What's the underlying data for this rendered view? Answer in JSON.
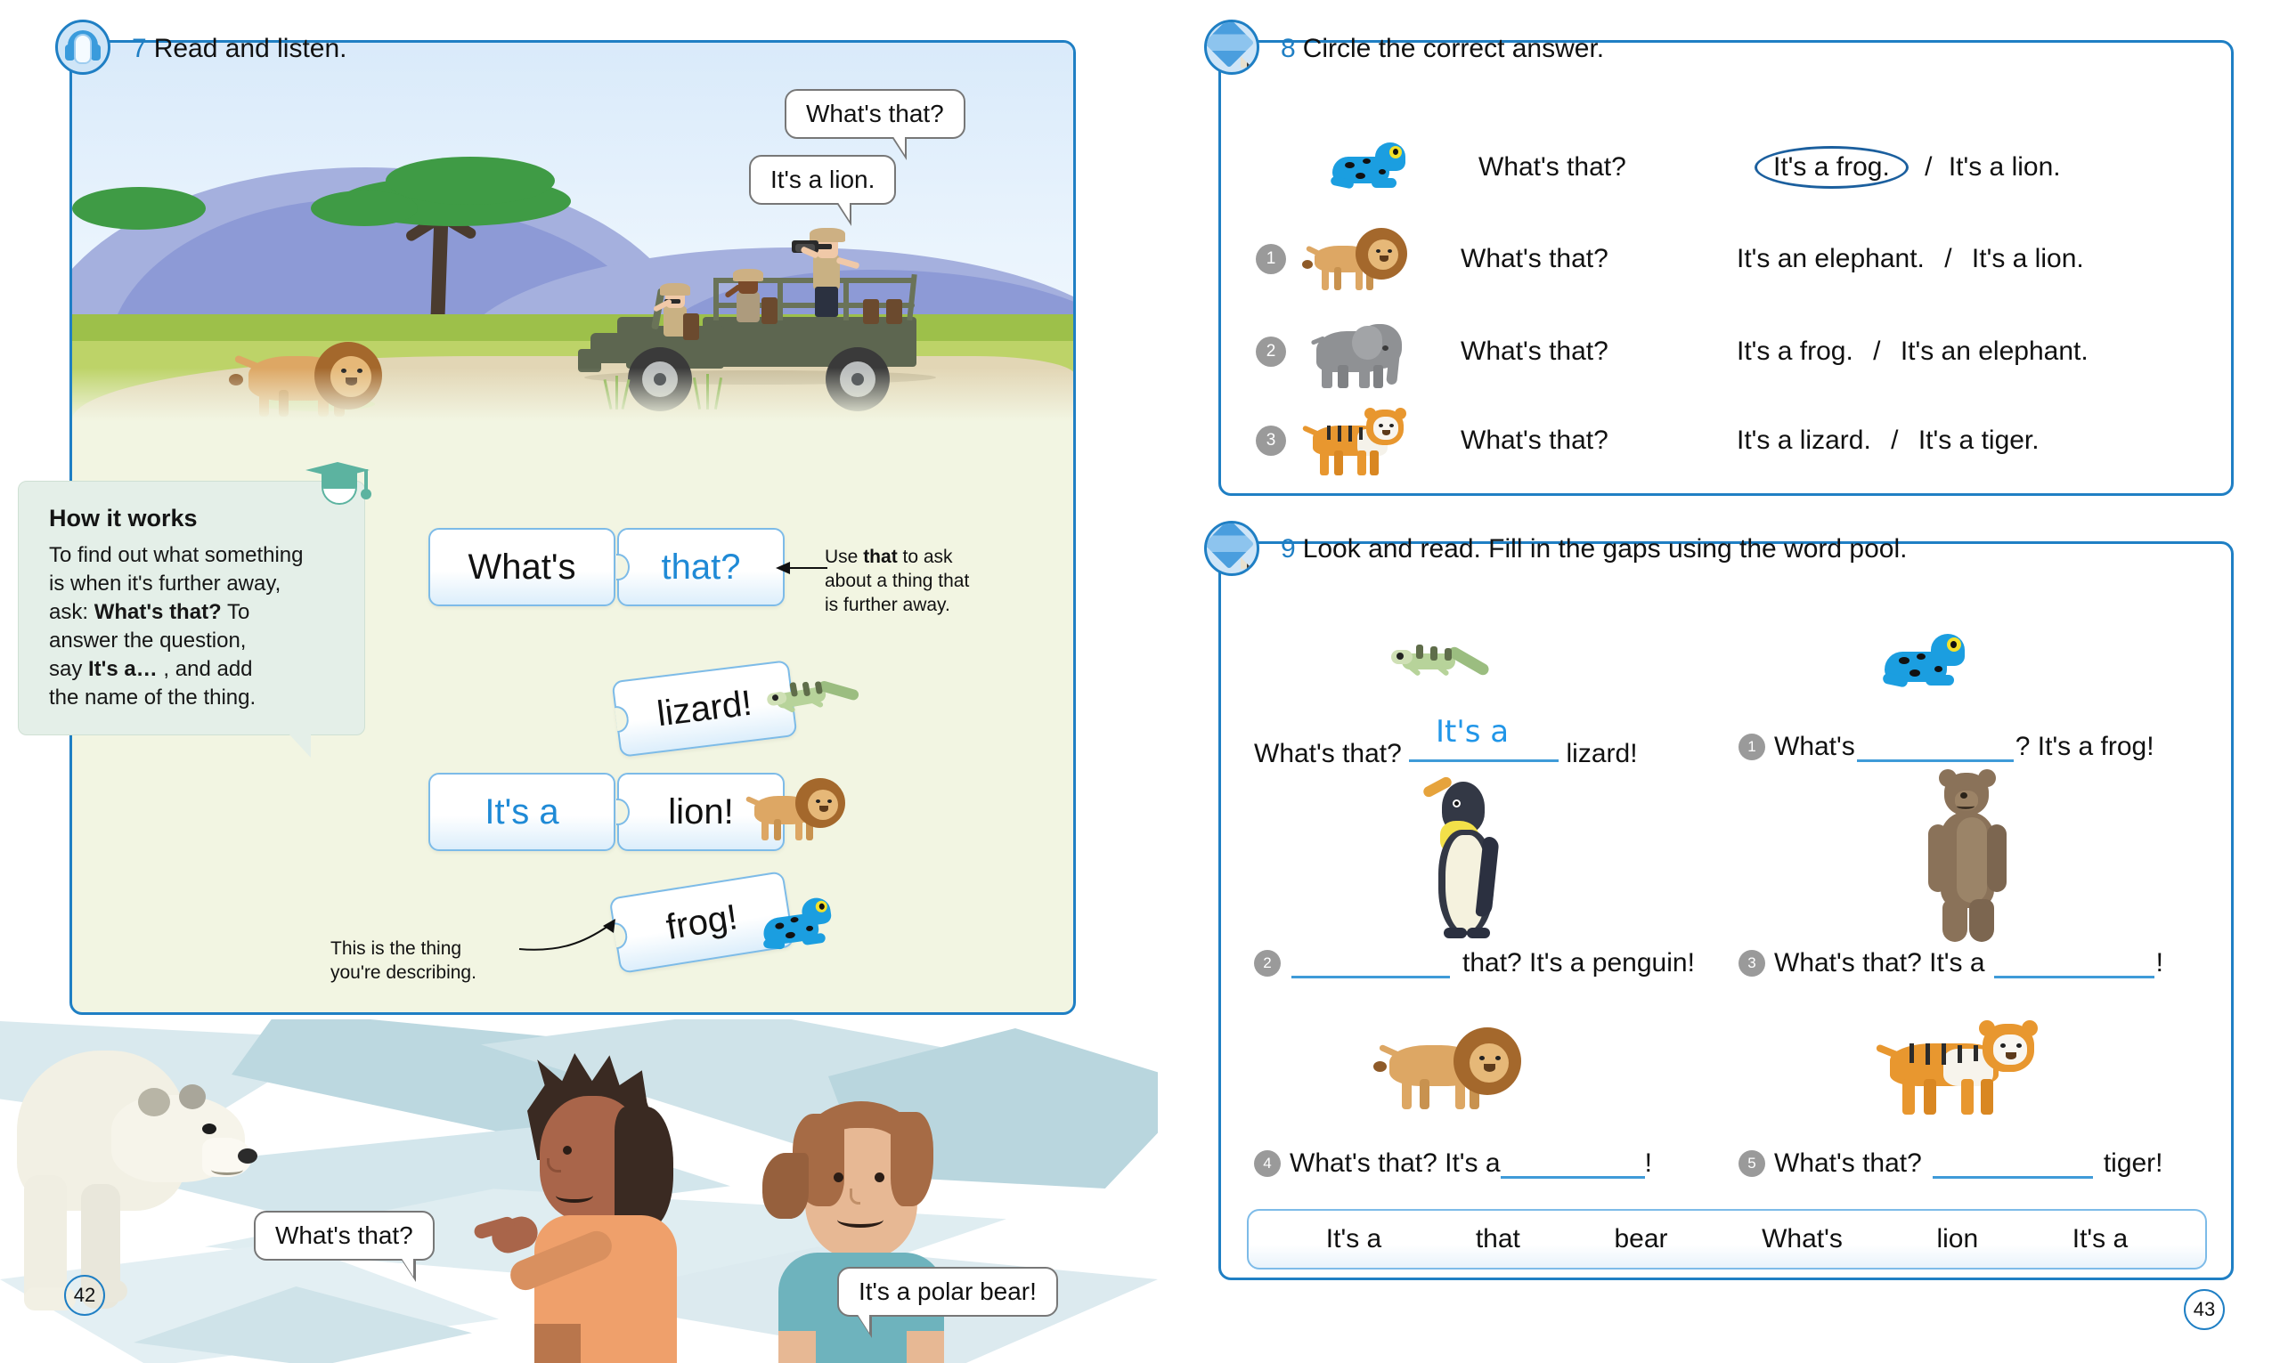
{
  "spread": {
    "left_page_number": "42",
    "right_page_number": "43"
  },
  "exercise7": {
    "number": "7",
    "title": "Read and listen.",
    "icon": "headphones-icon",
    "scene_bubbles": [
      {
        "text": "What's that?"
      },
      {
        "text": "It's a lion."
      }
    ],
    "how_it_works": {
      "heading": "How it works",
      "line1": "To find out what something",
      "line2": "is when it's further away,",
      "line3_pre": "ask: ",
      "line3_bold": "What's that?",
      "line3_post": " To",
      "line4": "answer the question,",
      "line5_pre": "say ",
      "line5_bold": "It's a…",
      "line5_post": " , and add",
      "line6": "the name of the thing."
    },
    "puzzle_cards": {
      "row1_left": "What's",
      "row1_right": "that?",
      "row2_single": "lizard!",
      "row3_left": "It's a",
      "row3_right": "lion!",
      "row4_single": "frog!"
    },
    "notes": {
      "note1_pre": "Use ",
      "note1_bold": "that",
      "note1_post": " to ask",
      "note1_l2": "about a thing that",
      "note1_l3": "is further away.",
      "note2_l1": "This is the thing",
      "note2_l2": "you're describing."
    },
    "arctic_bubbles": [
      {
        "text": "What's that?"
      },
      {
        "text": "It's a polar bear!"
      }
    ]
  },
  "exercise8": {
    "number": "8",
    "title": "Circle the correct answer.",
    "icon": "pencil-icon",
    "rows": [
      {
        "index": "",
        "animal": "frog",
        "question": "What's that?",
        "option_a": "It's a frog.",
        "separator": "/",
        "option_b": "It's a lion.",
        "circled": "a"
      },
      {
        "index": "1",
        "animal": "lion",
        "question": "What's that?",
        "option_a": "It's an elephant.",
        "separator": "/",
        "option_b": "It's a lion.",
        "circled": ""
      },
      {
        "index": "2",
        "animal": "elephant",
        "question": "What's that?",
        "option_a": "It's a frog.",
        "separator": "/",
        "option_b": "It's an elephant.",
        "circled": ""
      },
      {
        "index": "3",
        "animal": "tiger",
        "question": "What's that?",
        "option_a": "It's a lizard.",
        "separator": "/",
        "option_b": "It's a tiger.",
        "circled": ""
      }
    ]
  },
  "exercise9": {
    "number": "9",
    "title": "Look and read. Fill in the gaps using the word pool.",
    "icon": "pencil-icon",
    "items": [
      {
        "index": "",
        "animal": "lizard",
        "before": "What's that?",
        "filled": "It's a",
        "after": "lizard!"
      },
      {
        "index": "1",
        "animal": "frog",
        "before": "What's",
        "filled": "",
        "after": "? It's a frog!"
      },
      {
        "index": "2",
        "animal": "penguin",
        "before": "",
        "filled": "",
        "after": "that? It's a penguin!"
      },
      {
        "index": "3",
        "animal": "bear",
        "before": "What's that? It's a",
        "filled": "",
        "after": "!"
      },
      {
        "index": "4",
        "animal": "lion",
        "before": "What's that? It's a",
        "filled": "",
        "after": "!"
      },
      {
        "index": "5",
        "animal": "tiger",
        "before": "What's that?",
        "filled": "",
        "after": "tiger!"
      }
    ],
    "word_pool": [
      "It's a",
      "that",
      "bear",
      "What's",
      "lion",
      "It's a"
    ]
  },
  "colors": {
    "frame_blue": "#1f7fc4",
    "accent_blue": "#2196e8",
    "card_border": "#7dbbe8",
    "hiw_bg": "#e4efe8",
    "safari_bg": "#f2f5e2",
    "number_dot": "#9a9a9a"
  }
}
